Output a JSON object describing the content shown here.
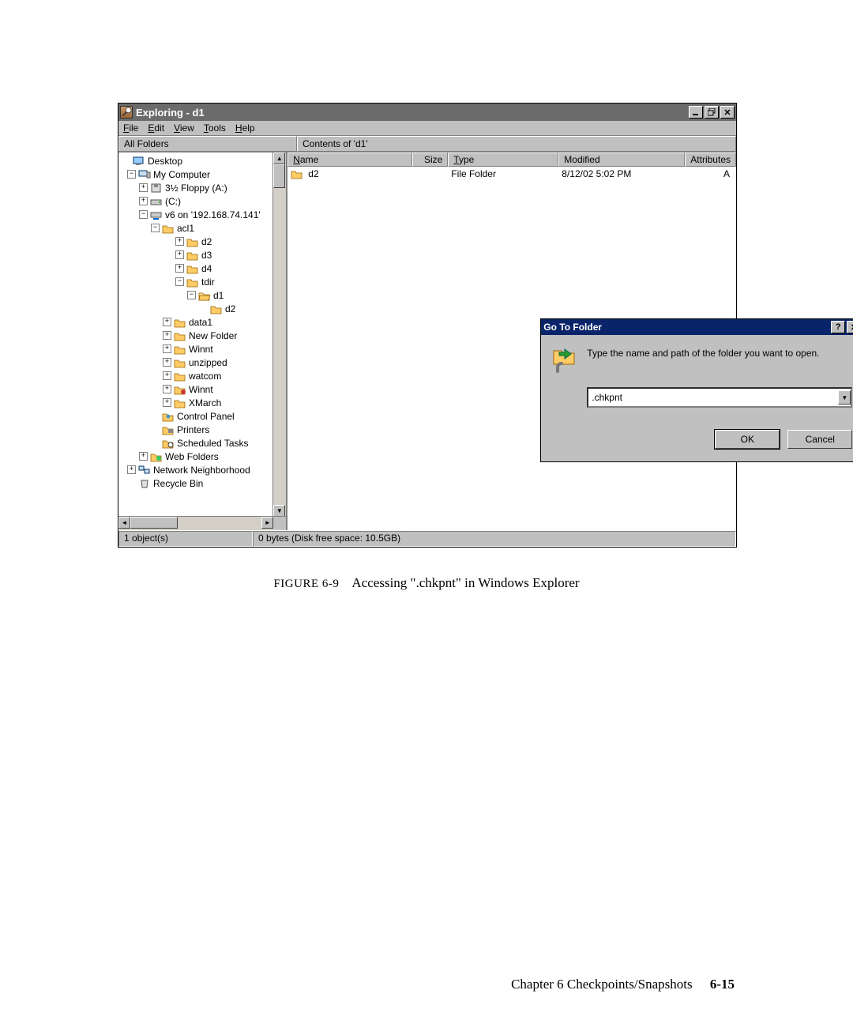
{
  "window": {
    "title": "Exploring - d1",
    "menus": {
      "file": "File",
      "edit": "Edit",
      "view": "View",
      "tools": "Tools",
      "help": "Help"
    },
    "left_header": "All Folders",
    "right_header": "Contents of 'd1'"
  },
  "tree": {
    "desktop": "Desktop",
    "mycomputer": "My Computer",
    "floppy": "3½ Floppy (A:)",
    "cdrive": "(C:)",
    "netdrive": "v6 on '192.168.74.141'",
    "acl1": "acl1",
    "d2": "d2",
    "d3": "d3",
    "d4": "d4",
    "tdir": "tdir",
    "d1": "d1",
    "d2b": "d2",
    "data1": "data1",
    "newfolder": "New Folder",
    "winnt": "Winnt",
    "unzipped": "unzipped",
    "watcom": "watcom",
    "winnt2": "Winnt",
    "xmarch": "XMarch",
    "controlpanel": "Control Panel",
    "printers": "Printers",
    "scheduled": "Scheduled Tasks",
    "webfolders": "Web Folders",
    "network": "Network Neighborhood",
    "recycle": "Recycle Bin"
  },
  "columns": {
    "name": "Name",
    "size": "Size",
    "type": "Type",
    "modified": "Modified",
    "attributes": "Attributes"
  },
  "rows": [
    {
      "name": "d2",
      "size": "",
      "type": "File Folder",
      "modified": "8/12/02 5:02 PM",
      "attr": "A"
    }
  ],
  "dialog": {
    "title": "Go To Folder",
    "prompt": "Type the name and path of the folder you want to open.",
    "value": ".chkpnt",
    "ok": "OK",
    "cancel": "Cancel"
  },
  "status": {
    "left": "1 object(s)",
    "right": "0 bytes (Disk free space: 10.5GB)"
  },
  "caption": {
    "fignum": "FIGURE 6-9",
    "text": "Accessing \".chkpnt\" in Windows Explorer"
  },
  "footer": {
    "chapter": "Chapter 6   Checkpoints/Snapshots",
    "page": "6-15"
  }
}
